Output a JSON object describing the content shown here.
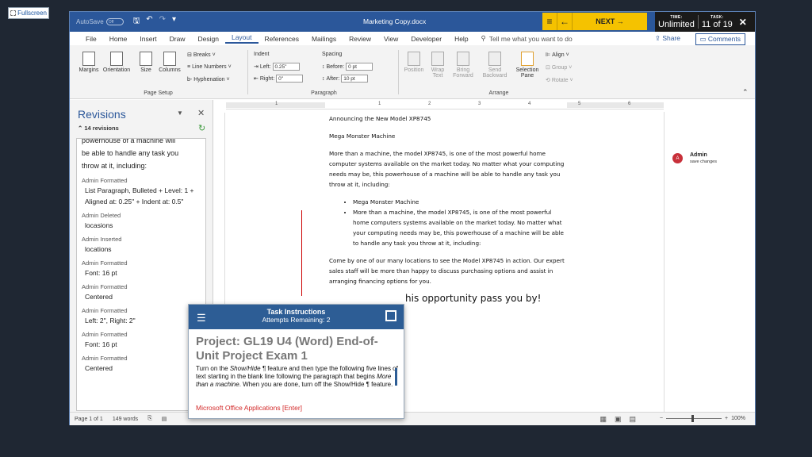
{
  "fullscreen": {
    "label": "Fullscreen",
    "icon": "expand-icon"
  },
  "titlebar": {
    "autosave_label": "AutoSave",
    "autosave_state": "Off",
    "document_title": "Marketing Copy.docx"
  },
  "exam_nav": {
    "next_label": "NEXT →",
    "time_label": "TIME:",
    "time_value": "Unlimited",
    "task_label": "TASK:",
    "task_value": "11 of 19"
  },
  "ribbon_tabs": [
    "File",
    "Home",
    "Insert",
    "Draw",
    "Design",
    "Layout",
    "References",
    "Mailings",
    "Review",
    "View",
    "Developer",
    "Help"
  ],
  "active_tab": "Layout",
  "tell_me": "Tell me what you want to do",
  "share_label": "Share",
  "comments_label": "Comments",
  "ribbon": {
    "page_setup": {
      "label": "Page Setup",
      "margins": "Margins",
      "orientation": "Orientation",
      "size": "Size",
      "columns": "Columns",
      "breaks": "Breaks ˅",
      "line_numbers": "Line Numbers ˅",
      "hyphenation": "Hyphenation ˅"
    },
    "paragraph": {
      "label": "Paragraph",
      "indent": "Indent",
      "spacing": "Spacing",
      "left_label": "Left:",
      "left_value": "0.25\"",
      "right_label": "Right:",
      "right_value": "0\"",
      "before_label": "Before:",
      "before_value": "0 pt",
      "after_label": "After:",
      "after_value": "10 pt"
    },
    "arrange": {
      "label": "Arrange",
      "position": "Position",
      "wrap_text": "Wrap Text",
      "bring_forward": "Bring Forward",
      "send_backward": "Send Backward",
      "selection_pane": "Selection Pane",
      "align": "Align ˅",
      "group": "Group ˅",
      "rotate": "Rotate ˅"
    }
  },
  "revisions": {
    "title": "Revisions",
    "count": "14 revisions",
    "lead_text": [
      "powerhouse of a machine will",
      "be able to handle any task you",
      "throw at it, including:"
    ],
    "entries": [
      {
        "who": "Admin Formatted",
        "detail": "List Paragraph, Bulleted + Level: 1 + Aligned at: 0.25\" + Indent at: 0.5\""
      },
      {
        "who": "Admin Deleted",
        "detail": "locasions"
      },
      {
        "who": "Admin Inserted",
        "detail": "locations"
      },
      {
        "who": "Admin Formatted",
        "detail": "Font: 16 pt"
      },
      {
        "who": "Admin Formatted",
        "detail": "Centered"
      },
      {
        "who": "Admin Formatted",
        "detail": "Left:  2\", Right:  2\""
      },
      {
        "who": "Admin Formatted",
        "detail": "Font: 16 pt"
      },
      {
        "who": "Admin Formatted",
        "detail": "Centered"
      }
    ]
  },
  "document": {
    "heading": "Announcing the New Model XP8745",
    "subheading": "Mega Monster Machine",
    "para1": "More than a machine, the model XP8745, is one of the most powerful home computer systems available on the market today. No matter what your computing needs may be, this powerhouse of a machine will be able to handle any task you throw at it, including:",
    "bullets": [
      "Mega Monster Machine",
      "More than a machine, the model XP8745, is one of the most powerful home computers systems available on the market today. No matter what your computing needs may be, this powerhouse of a machine will be able to handle any task you throw at it, including:"
    ],
    "para2": "Come by one of our many locations to see the Model XP8745 in action. Our expert sales staff will be more than happy to discuss purchasing options and assist in arranging financing options for you.",
    "closing": "his opportunity pass you by!"
  },
  "comment": {
    "avatar": "A",
    "author": "Admin",
    "text": "save changes"
  },
  "status_bar": {
    "page": "Page 1 of 1",
    "words": "149 words",
    "zoom": "100%"
  },
  "task_panel": {
    "title": "Task Instructions",
    "attempts": "Attempts Remaining: 2",
    "project": "Project: GL19 U4 (Word) End-of-Unit Project Exam 1",
    "instructions_parts": [
      "Turn on the ",
      "Show/Hide ¶",
      " feature and then type the following five lines of text starting in the blank line following the paragraph that begins ",
      "More than a machine",
      ". When you are done, turn off the Show/Hide ¶ feature."
    ],
    "footer_link": "Microsoft Office Applications [Enter]"
  }
}
